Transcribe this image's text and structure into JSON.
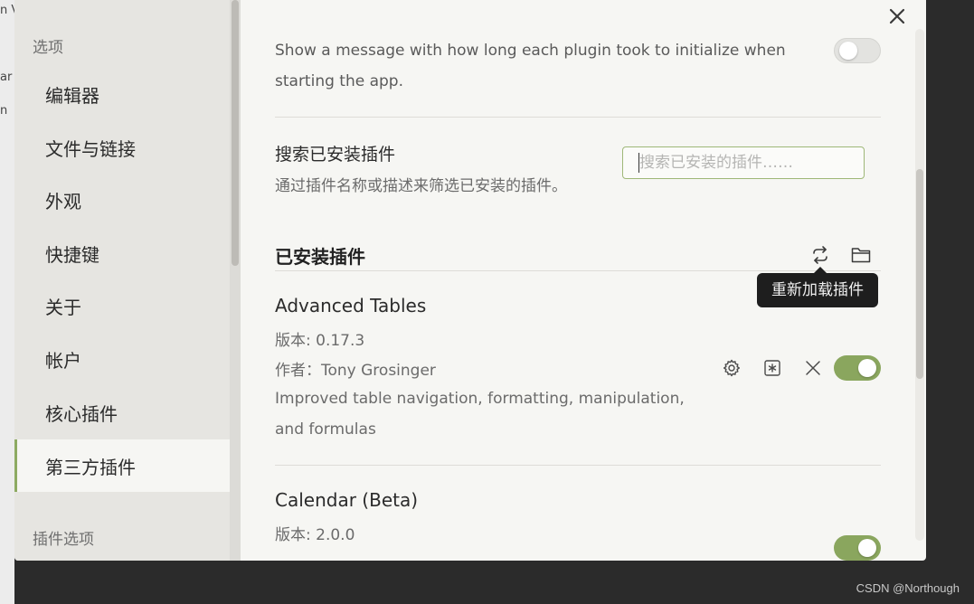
{
  "background": {
    "fragments": [
      "n V",
      "ar",
      "n"
    ],
    "watermark": "CSDN @Northough"
  },
  "sidebar": {
    "options_label": "选项",
    "items": [
      {
        "label": "编辑器"
      },
      {
        "label": "文件与链接"
      },
      {
        "label": "外观"
      },
      {
        "label": "快捷键"
      },
      {
        "label": "关于"
      },
      {
        "label": "帐户"
      },
      {
        "label": "核心插件"
      },
      {
        "label": "第三方插件",
        "active": true
      }
    ],
    "plugin_options_label": "插件选项"
  },
  "content": {
    "startup_time": {
      "description": "Show a message with how long each plugin took to initialize when starting the app.",
      "enabled": false
    },
    "search": {
      "title": "搜索已安装插件",
      "subtitle": "通过插件名称或描述来筛选已安装的插件。",
      "placeholder": "搜索已安装的插件……",
      "value": ""
    },
    "installed": {
      "heading": "已安装插件",
      "reload_icon": "reload-icon",
      "folder_icon": "folder-icon",
      "tooltip": "重新加载插件"
    },
    "plugins": [
      {
        "name": "Advanced Tables",
        "version": "版本: 0.17.3",
        "author": "作者：Tony Grosinger",
        "description": "Improved table navigation, formatting, manipulation, and formulas",
        "enabled": true
      },
      {
        "name": "Calendar (Beta)",
        "version": "版本: 2.0.0",
        "enabled": true
      }
    ]
  },
  "colors": {
    "accent": "#8aa65e",
    "modal_bg": "#f6f6f3",
    "sidebar_bg": "#e6e5e1",
    "tooltip_bg": "#1e1e1e"
  }
}
